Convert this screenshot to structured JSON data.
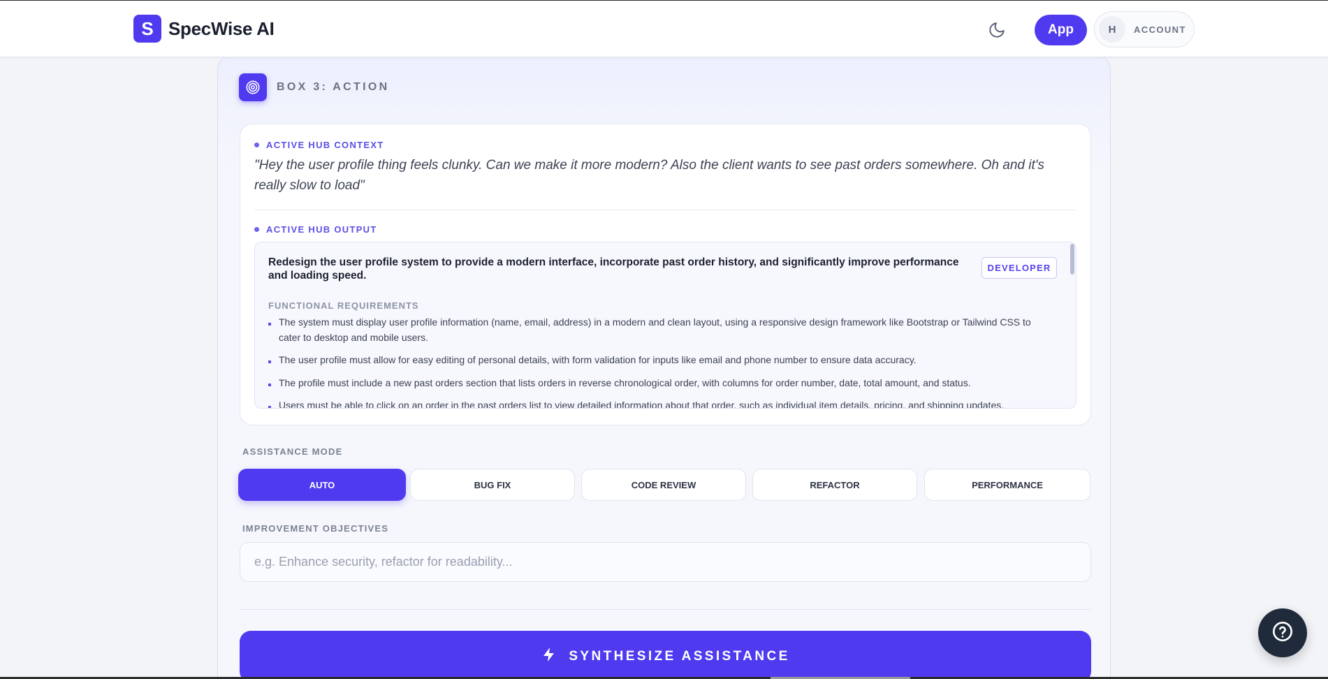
{
  "header": {
    "brand_initial": "S",
    "brand_name": "SpecWise AI",
    "theme_icon": "moon-icon",
    "app_label": "App",
    "account_initial": "H",
    "account_label": "ACCOUNT"
  },
  "box": {
    "icon": "target-icon",
    "title": "BOX 3: ACTION"
  },
  "hub": {
    "context_label": "ACTIVE HUB CONTEXT",
    "context_quote": "\"Hey the user profile thing feels clunky. Can we make it more modern? Also the client wants to see past orders somewhere. Oh and it's really slow to load\"",
    "output_label": "ACTIVE HUB OUTPUT",
    "output": {
      "summary": "Redesign the user profile system to provide a modern interface, incorporate past order history, and significantly improve performance and loading speed.",
      "role_badge": "DEVELOPER",
      "requirements_label": "FUNCTIONAL REQUIREMENTS",
      "requirements": [
        "The system must display user profile information (name, email, address) in a modern and clean layout, using a responsive design framework like Bootstrap or Tailwind CSS to cater to desktop and mobile users.",
        "The user profile must allow for easy editing of personal details, with form validation for inputs like email and phone number to ensure data accuracy.",
        "The profile must include a new past orders section that lists orders in reverse chronological order, with columns for order number, date, total amount, and status.",
        "Users must be able to click on an order in the past orders list to view detailed information about that order, such as individual item details, pricing, and shipping updates."
      ]
    }
  },
  "assistance": {
    "label": "ASSISTANCE MODE",
    "modes": [
      "AUTO",
      "BUG FIX",
      "CODE REVIEW",
      "REFACTOR",
      "PERFORMANCE"
    ],
    "selected": "AUTO"
  },
  "objectives": {
    "label": "IMPROVEMENT OBJECTIVES",
    "value": "",
    "placeholder": "e.g. Enhance security, refactor for readability..."
  },
  "synthesize": {
    "icon": "lightning-icon",
    "label": "SYNTHESIZE ASSISTANCE"
  },
  "help": {
    "icon": "help-circle-icon"
  },
  "colors": {
    "accent": "#4f3af0",
    "fab": "#1f2a3a"
  }
}
